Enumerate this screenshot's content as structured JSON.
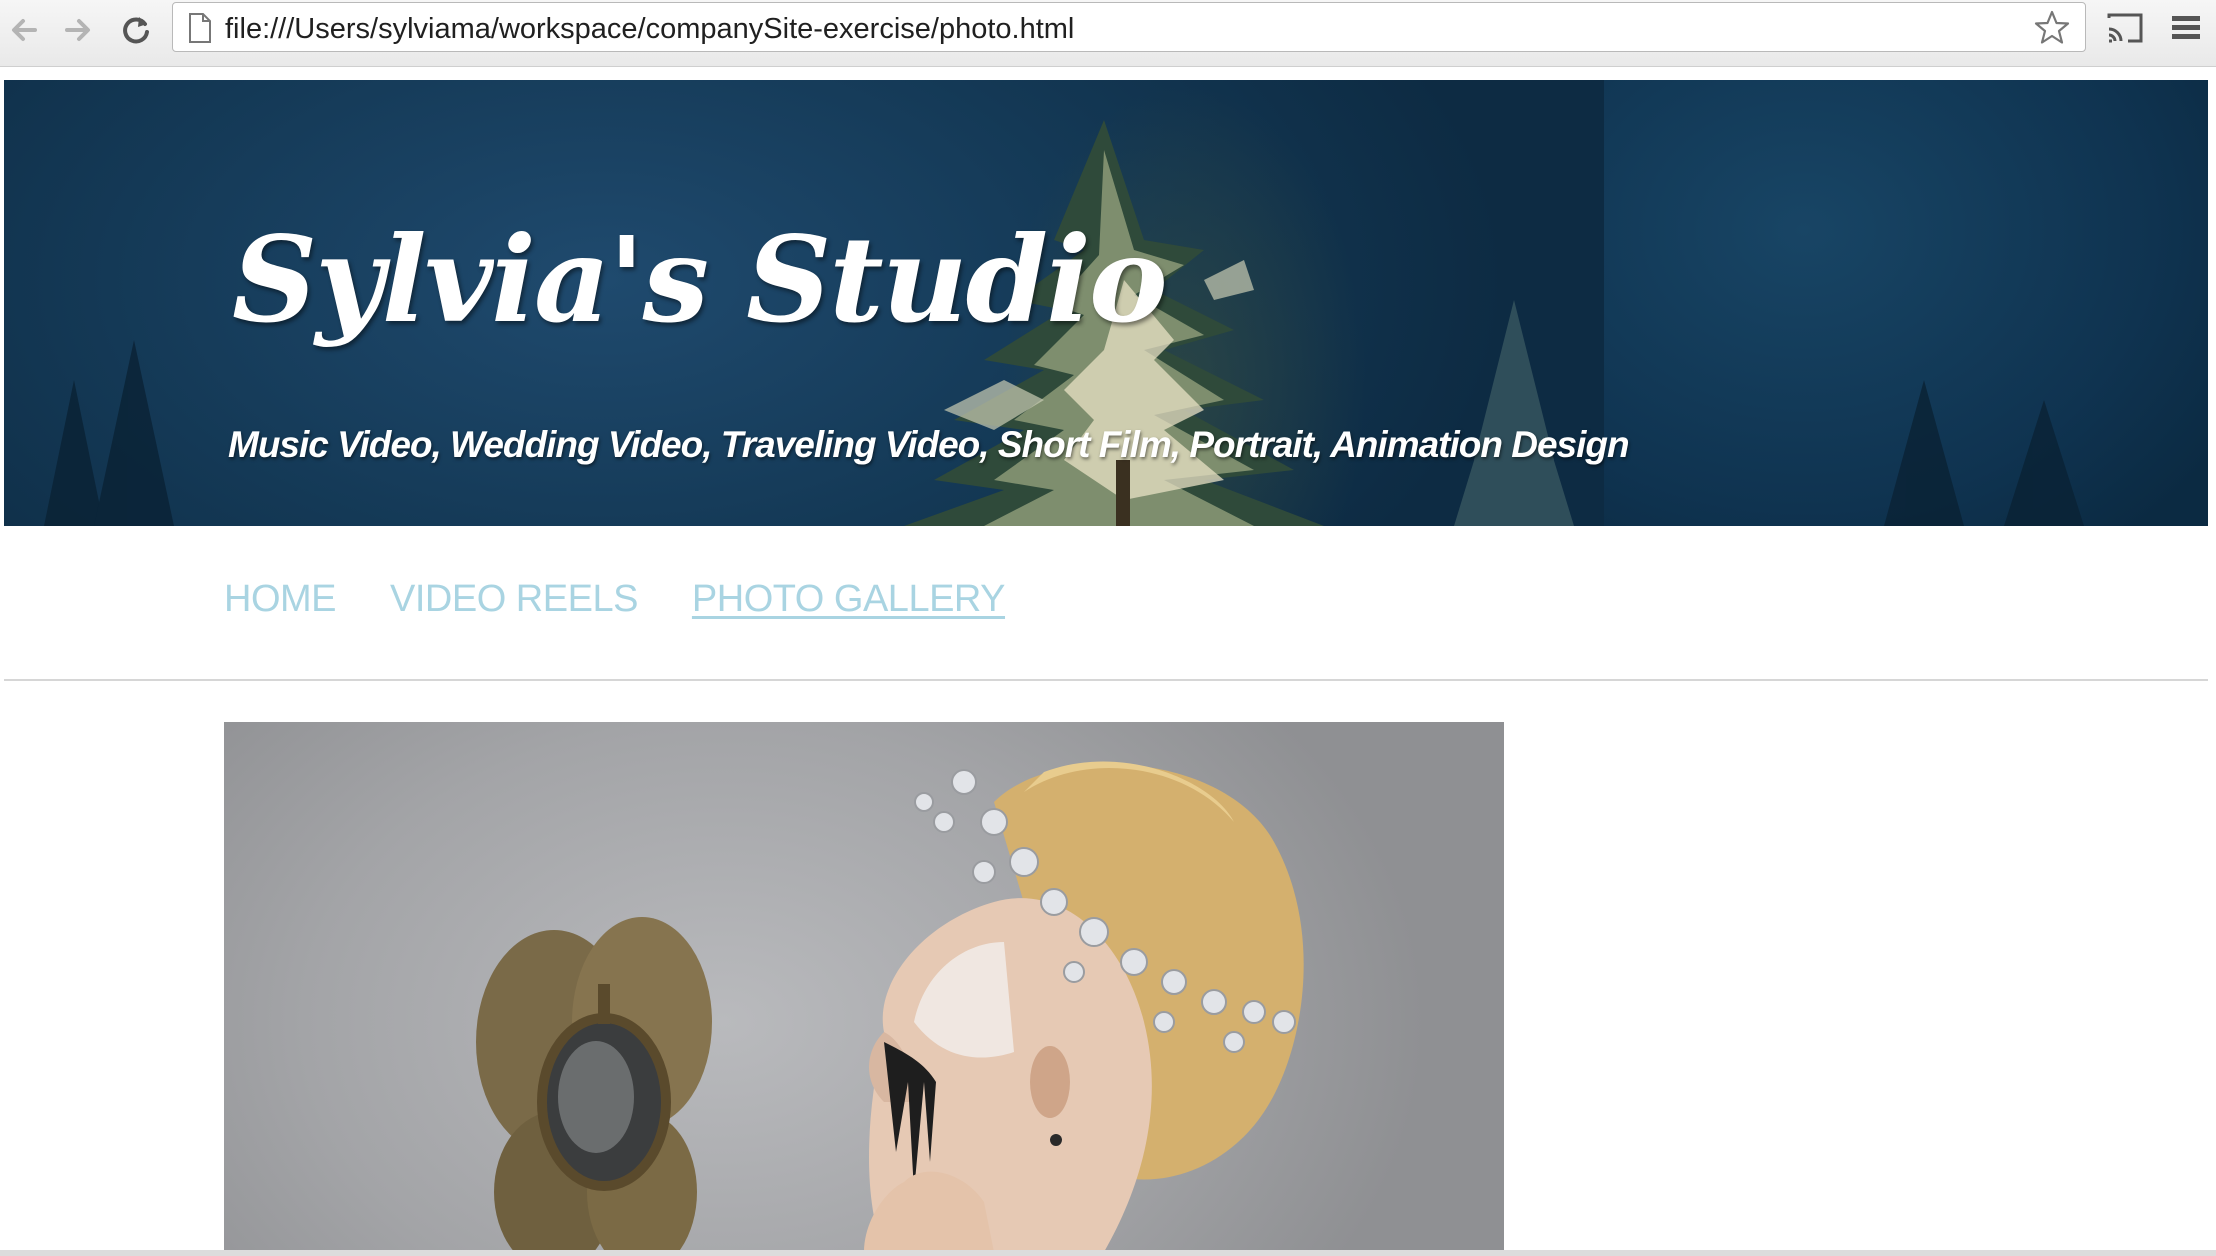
{
  "browser": {
    "back_icon": "back-arrow-icon",
    "forward_icon": "forward-arrow-icon",
    "reload_icon": "reload-icon",
    "url": "file:///Users/sylviama/workspace/companySite-exercise/photo.html",
    "bookmark_icon": "star-icon",
    "cast_icon": "cast-icon",
    "menu_icon": "hamburger-menu-icon"
  },
  "banner": {
    "title": "Sylvia's Studio",
    "subtitle": "Music Video, Wedding Video, Traveling Video, Short Film, Portrait, Animation Design"
  },
  "nav": {
    "items": [
      {
        "label": "HOME",
        "active": false
      },
      {
        "label": "VIDEO REELS",
        "active": false
      },
      {
        "label": "PHOTO GALLERY",
        "active": true
      }
    ]
  },
  "colors": {
    "nav_link": "#a9d4e2",
    "banner_bg": "#143956",
    "text_on_banner": "#ffffff"
  }
}
